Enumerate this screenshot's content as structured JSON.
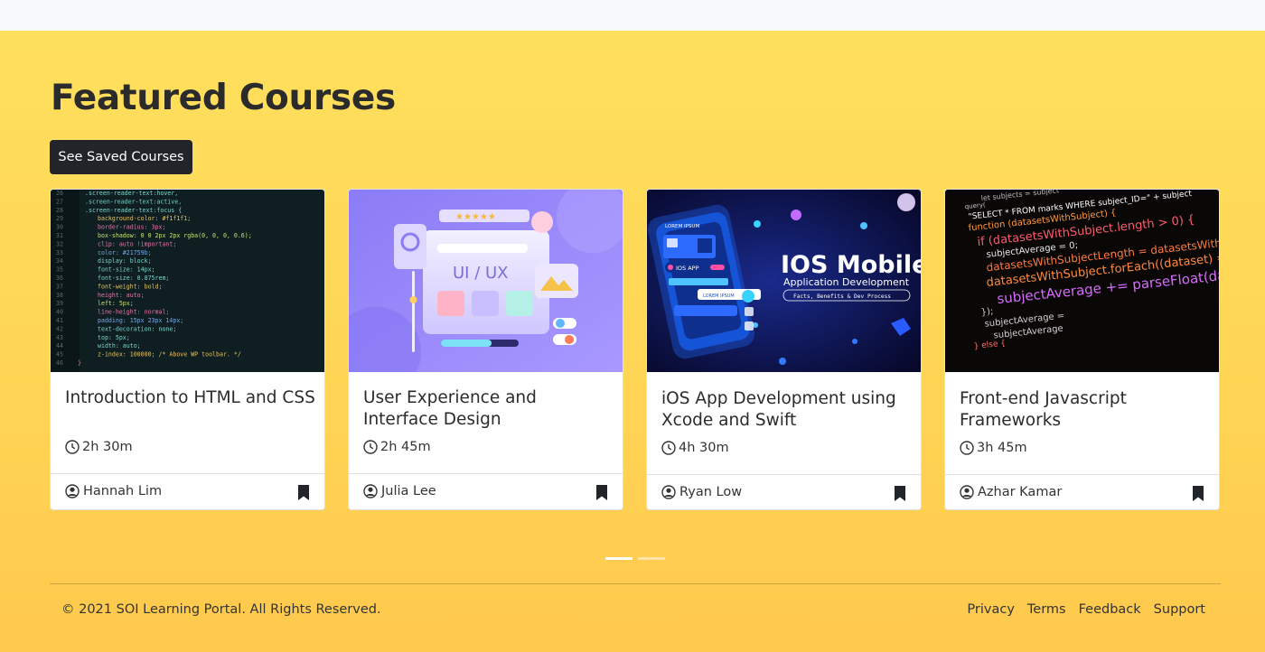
{
  "header": {
    "title": "Featured Courses",
    "saved_button_label": "See Saved Courses"
  },
  "courses": [
    {
      "title": "Introduction to HTML and CSS",
      "duration": "2h 30m",
      "author": "Hannah Lim",
      "image": "html-css-code-editor",
      "code_lines": [
        {
          "n": "26",
          "t": ".screen-reader-text:hover,"
        },
        {
          "n": "27",
          "t": ".screen-reader-text:active,"
        },
        {
          "n": "28",
          "t": ".screen-reader-text:focus {"
        },
        {
          "n": "29",
          "t": "background-color: #f1f1f1;"
        },
        {
          "n": "30",
          "t": "border-radius: 3px;"
        },
        {
          "n": "31",
          "t": "box-shadow: 0 0 2px 2px rgba(0, 0, 0, 0.6);"
        },
        {
          "n": "32",
          "t": "clip: auto !important;"
        },
        {
          "n": "33",
          "t": "color: #21759b;"
        },
        {
          "n": "34",
          "t": "display: block;"
        },
        {
          "n": "35",
          "t": "font-size: 14px;"
        },
        {
          "n": "36",
          "t": "font-size: 0.875rem;"
        },
        {
          "n": "37",
          "t": "font-weight: bold;"
        },
        {
          "n": "38",
          "t": "height: auto;"
        },
        {
          "n": "39",
          "t": "left: 5px;"
        },
        {
          "n": "40",
          "t": "line-height: normal;"
        },
        {
          "n": "41",
          "t": "padding: 15px 23px 14px;"
        },
        {
          "n": "42",
          "t": "text-decoration: none;"
        },
        {
          "n": "43",
          "t": "top: 5px;"
        },
        {
          "n": "44",
          "t": "width: auto;"
        },
        {
          "n": "45",
          "t": "z-index: 100000; /* Above WP toolbar. */"
        },
        {
          "n": "46",
          "t": "}"
        }
      ]
    },
    {
      "title": "User Experience and Interface Design",
      "duration": "2h 45m",
      "author": "Julia Lee",
      "image": "ui-ux-illustration",
      "image_text": "UI / UX"
    },
    {
      "title": "iOS App Development using Xcode and Swift",
      "duration": "4h 30m",
      "author": "Ryan Low",
      "image": "ios-mobile-illustration",
      "image_heading": "IOS Mobile",
      "image_subheading": "Application Development",
      "image_tagline": "Facts, Benefits & Dev Process",
      "phone_badge": "IOS APP",
      "phone_top_label": "LOREM IPSUM",
      "phone_mid_label": "LOREM IPSUM"
    },
    {
      "title": "Front-end Javascript Frameworks",
      "duration": "3h 45m",
      "author": "Azhar Kamar",
      "image": "javascript-code-photo",
      "code_lines": [
        "let subjects = subject",
        "query(",
        "\"SELECT * FROM marks WHERE subject_ID=\" + subject",
        "function (datasetsWithSubject) {",
        "if (datasetsWithSubject.length > 0) {",
        "subjectAverage = 0;",
        "datasetsWithSubjectLength = datasetsWithSu",
        "datasetsWithSubject.forEach((dataset) => {",
        "subjectAverage += parseFloat(dataset[\"",
        "});",
        "subjectAverage =",
        "subjectAverage",
        "} else {"
      ]
    }
  ],
  "carousel": {
    "slides": 2,
    "active_index": 0
  },
  "footer": {
    "copyright": "© 2021 SOI Learning Portal. All Rights Reserved.",
    "links": [
      "Privacy",
      "Terms",
      "Feedback",
      "Support"
    ]
  },
  "colors": {
    "hero_top": "#ffe05e",
    "hero_bottom": "#ffc94d",
    "button_dark": "#212529",
    "card_bg": "#ffffff"
  }
}
